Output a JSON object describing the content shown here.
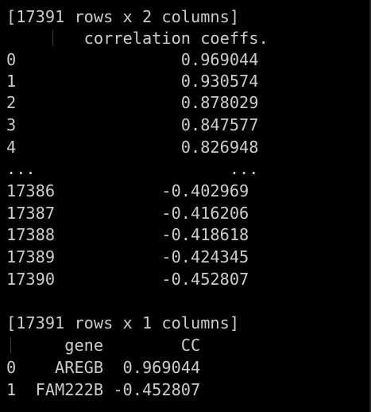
{
  "colors": {
    "background": "#000000",
    "text": "#cccccc",
    "guide": "#3a3a3a"
  },
  "block1": {
    "shape_line": "[17391 rows x 2 columns]",
    "header_line": "        correlation coeffs.",
    "rows": [
      "0                 0.969044",
      "1                 0.930574",
      "2                 0.878029",
      "3                 0.847577",
      "4                 0.826948",
      "...                    ...",
      "17386           -0.402969",
      "17387           -0.416206",
      "17388           -0.418618",
      "17389           -0.424345",
      "17390           -0.452807"
    ]
  },
  "block2": {
    "shape_line": "[17391 rows x 1 columns]",
    "header_line": "      gene        CC",
    "rows": [
      "0    AREGB  0.969044",
      "1  FAM222B -0.452807"
    ]
  }
}
